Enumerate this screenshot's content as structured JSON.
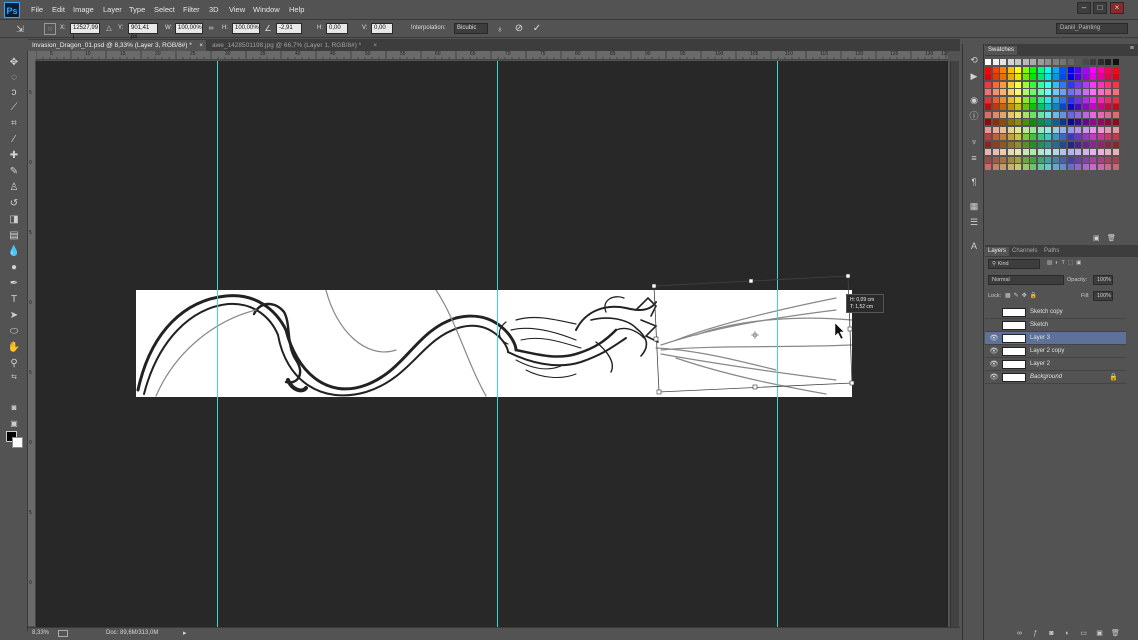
{
  "app": {
    "logo": "Ps"
  },
  "menu": [
    "File",
    "Edit",
    "Image",
    "Layer",
    "Type",
    "Select",
    "Filter",
    "3D",
    "View",
    "Window",
    "Help"
  ],
  "options_bar": {
    "x_label": "X:",
    "x_value": "12527,99 j",
    "y_label": "Y:",
    "y_value": "901,41 px",
    "w_label": "W:",
    "w_value": "100,00%",
    "h_label": "H:",
    "h_value": "100,00%",
    "angle_value": "-2,91",
    "hskew_label": "H:",
    "hskew_value": "0,00",
    "vskew_label": "V:",
    "vskew_value": "0,00",
    "interp_label": "Interpolation:",
    "interp_value": "Bicubic"
  },
  "workspace": "Daniil_Painting",
  "tabs": [
    {
      "label": "Invasion_Dragon_01.psd @ 8,33% (Layer 3, RGB/8#) *",
      "close": "×"
    },
    {
      "label": "awe_1428501198.jpg @ 66,7% (Layer 1, RGB/8#) *",
      "close": "×"
    }
  ],
  "ruler_labels": [
    "5",
    "10",
    "15",
    "20",
    "25",
    "30",
    "35",
    "40",
    "45",
    "50",
    "55",
    "60",
    "65",
    "70",
    "75",
    "80",
    "85",
    "90",
    "95",
    "100",
    "105",
    "110",
    "115",
    "120",
    "125",
    "130",
    "135"
  ],
  "vruler_labels": [
    "5",
    "0",
    "5",
    "0",
    "5",
    "0",
    "5",
    "0"
  ],
  "transform_tooltip": {
    "line1": "H: 0,09 cm",
    "line2": "T: 1,52 cm"
  },
  "status": {
    "zoom": "8,33%",
    "doc": "Doc: 89,6M/313,0M"
  },
  "swatches_panel": {
    "tab": "Swatches"
  },
  "layers_panel": {
    "tabs": [
      "Layers",
      "Channels",
      "Paths"
    ],
    "kind": "Kind",
    "blend": "Normal",
    "opacity_label": "Opacity:",
    "opacity_value": "100%",
    "lock_label": "Lock:",
    "fill_label": "Fill:",
    "fill_value": "100%",
    "layers": [
      {
        "name": "Sketch copy",
        "visible": false,
        "selected": false,
        "italic": false
      },
      {
        "name": "Sketch",
        "visible": false,
        "selected": false,
        "italic": false
      },
      {
        "name": "Layer 3",
        "visible": true,
        "selected": true,
        "italic": false
      },
      {
        "name": "Layer 2 copy",
        "visible": true,
        "selected": false,
        "italic": false
      },
      {
        "name": "Layer 2",
        "visible": true,
        "selected": false,
        "italic": false
      },
      {
        "name": "Background",
        "visible": true,
        "selected": false,
        "italic": true
      }
    ]
  },
  "colors": {
    "accent_guide": "#38d8d8",
    "selected_layer": "#5d7199",
    "ps_blue": "#31a8ff"
  }
}
